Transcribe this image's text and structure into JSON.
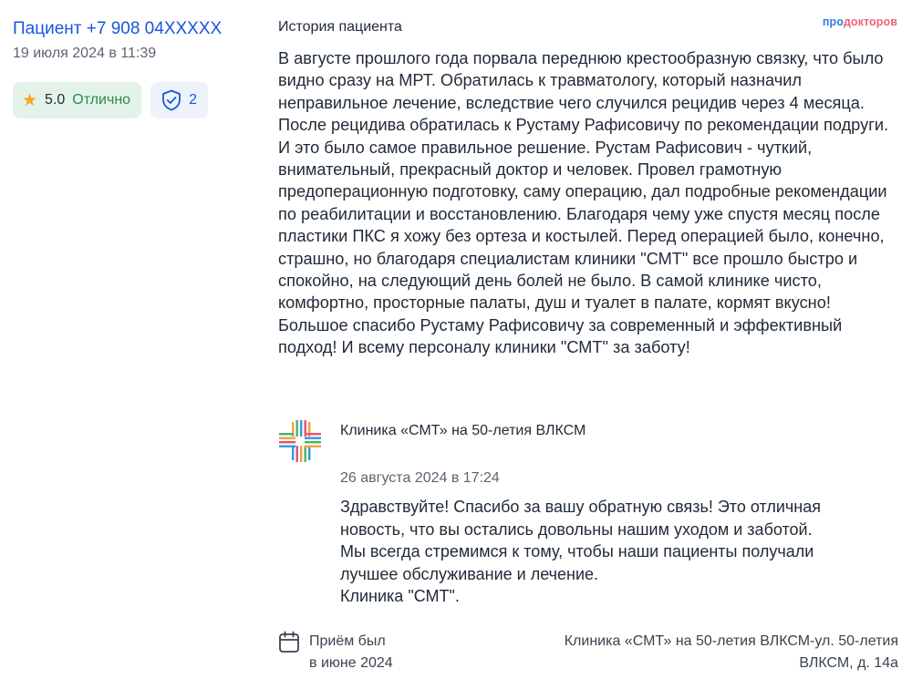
{
  "author": {
    "name": "Пациент +7 908 04XXXXX",
    "date": "19 июля 2024 в 11:39"
  },
  "rating": {
    "value": "5.0",
    "label": "Отлично",
    "star_icon": "star-icon",
    "star_color": "#f5a623"
  },
  "verified": {
    "count": "2",
    "icon": "shield-check-icon"
  },
  "brand": {
    "part1": "про",
    "part2": "докторов",
    "color1": "#2e7de1",
    "color2": "#f06373"
  },
  "story": {
    "title": "История пациента",
    "text": "В августе прошлого года порвала переднюю крестообразную связку, что было видно сразу на МРТ. Обратилась к травматологу, который назначил неправильное лечение, вследствие чего случился рецидив через 4 месяца. После рецидива обратилась к Рустаму Рафисовичу по рекомендации подруги. И это было самое правильное решение. Рустам Рафисович - чуткий, внимательный, прекрасный доктор и человек. Провел грамотную предоперационную подготовку, саму операцию, дал подробные рекомендации по реабилитации и восстановлению. Благодаря чему уже спустя месяц после пластики ПКС я хожу без ортеза и костылей. Перед операцией было, конечно, страшно, но благодаря специалистам клиники \"СМТ\" все прошло быстро и спокойно, на следующий день болей не было. В самой клинике чисто, комфортно, просторные палаты, душ и туалет в палате, кормят вкусно! Большое спасибо Рустаму Рафисовичу за современный и эффективный подход! И всему персоналу клиники \"СМТ\" за заботу!"
  },
  "reply": {
    "clinic": "Клиника «СМТ» на 50-летия ВЛКСМ",
    "logo_icon": "clinic-cross-logo",
    "date": "26 августа 2024 в 17:24",
    "lines": [
      "Здравствуйте! Спасибо за вашу обратную связь! Это отличная",
      "новость, что вы остались довольны нашим уходом и заботой.",
      "Мы всегда стремимся к тому, чтобы наши пациенты получали",
      "лучшее обслуживание и лечение.",
      "Клиника \"СМТ\"."
    ]
  },
  "visit": {
    "icon": "calendar-icon",
    "line1": "Приём был",
    "line2": "в июне 2024"
  },
  "location": {
    "line1": "Клиника «СМТ» на 50-летия ВЛКСМ-ул. 50-летия",
    "line2": "ВЛКСМ, д. 14а"
  }
}
